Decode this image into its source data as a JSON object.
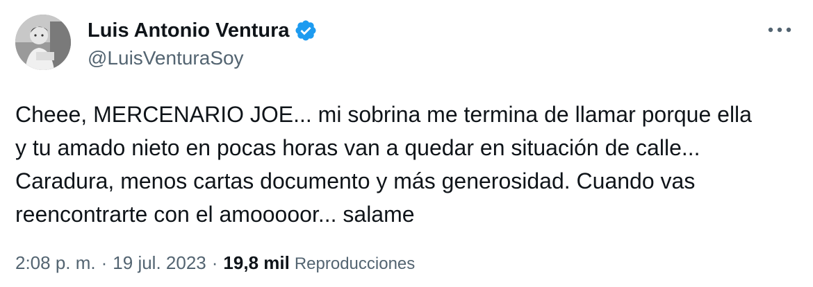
{
  "author": {
    "display_name": "Luis Antonio Ventura",
    "handle": "@LuisVenturaSoy",
    "verified_icon": "verified-badge-icon"
  },
  "menu": {
    "icon": "more-options-icon"
  },
  "tweet": {
    "text": "Cheee, MERCENARIO JOE... mi sobrina me termina de llamar porque ella\ny tu amado nieto en pocas horas van a quedar en situación de calle...\nCaradura, menos cartas documento y más generosidad. Cuando vas\nreencontrarte con el amooooor... salame"
  },
  "meta": {
    "time": "2:08 p. m.",
    "separator": "·",
    "date": "19 jul. 2023",
    "views_count": "19,8 mil",
    "views_label": "Reproducciones"
  },
  "colors": {
    "text": "#0f1419",
    "secondary": "#536471",
    "verified": "#1d9bf0"
  }
}
